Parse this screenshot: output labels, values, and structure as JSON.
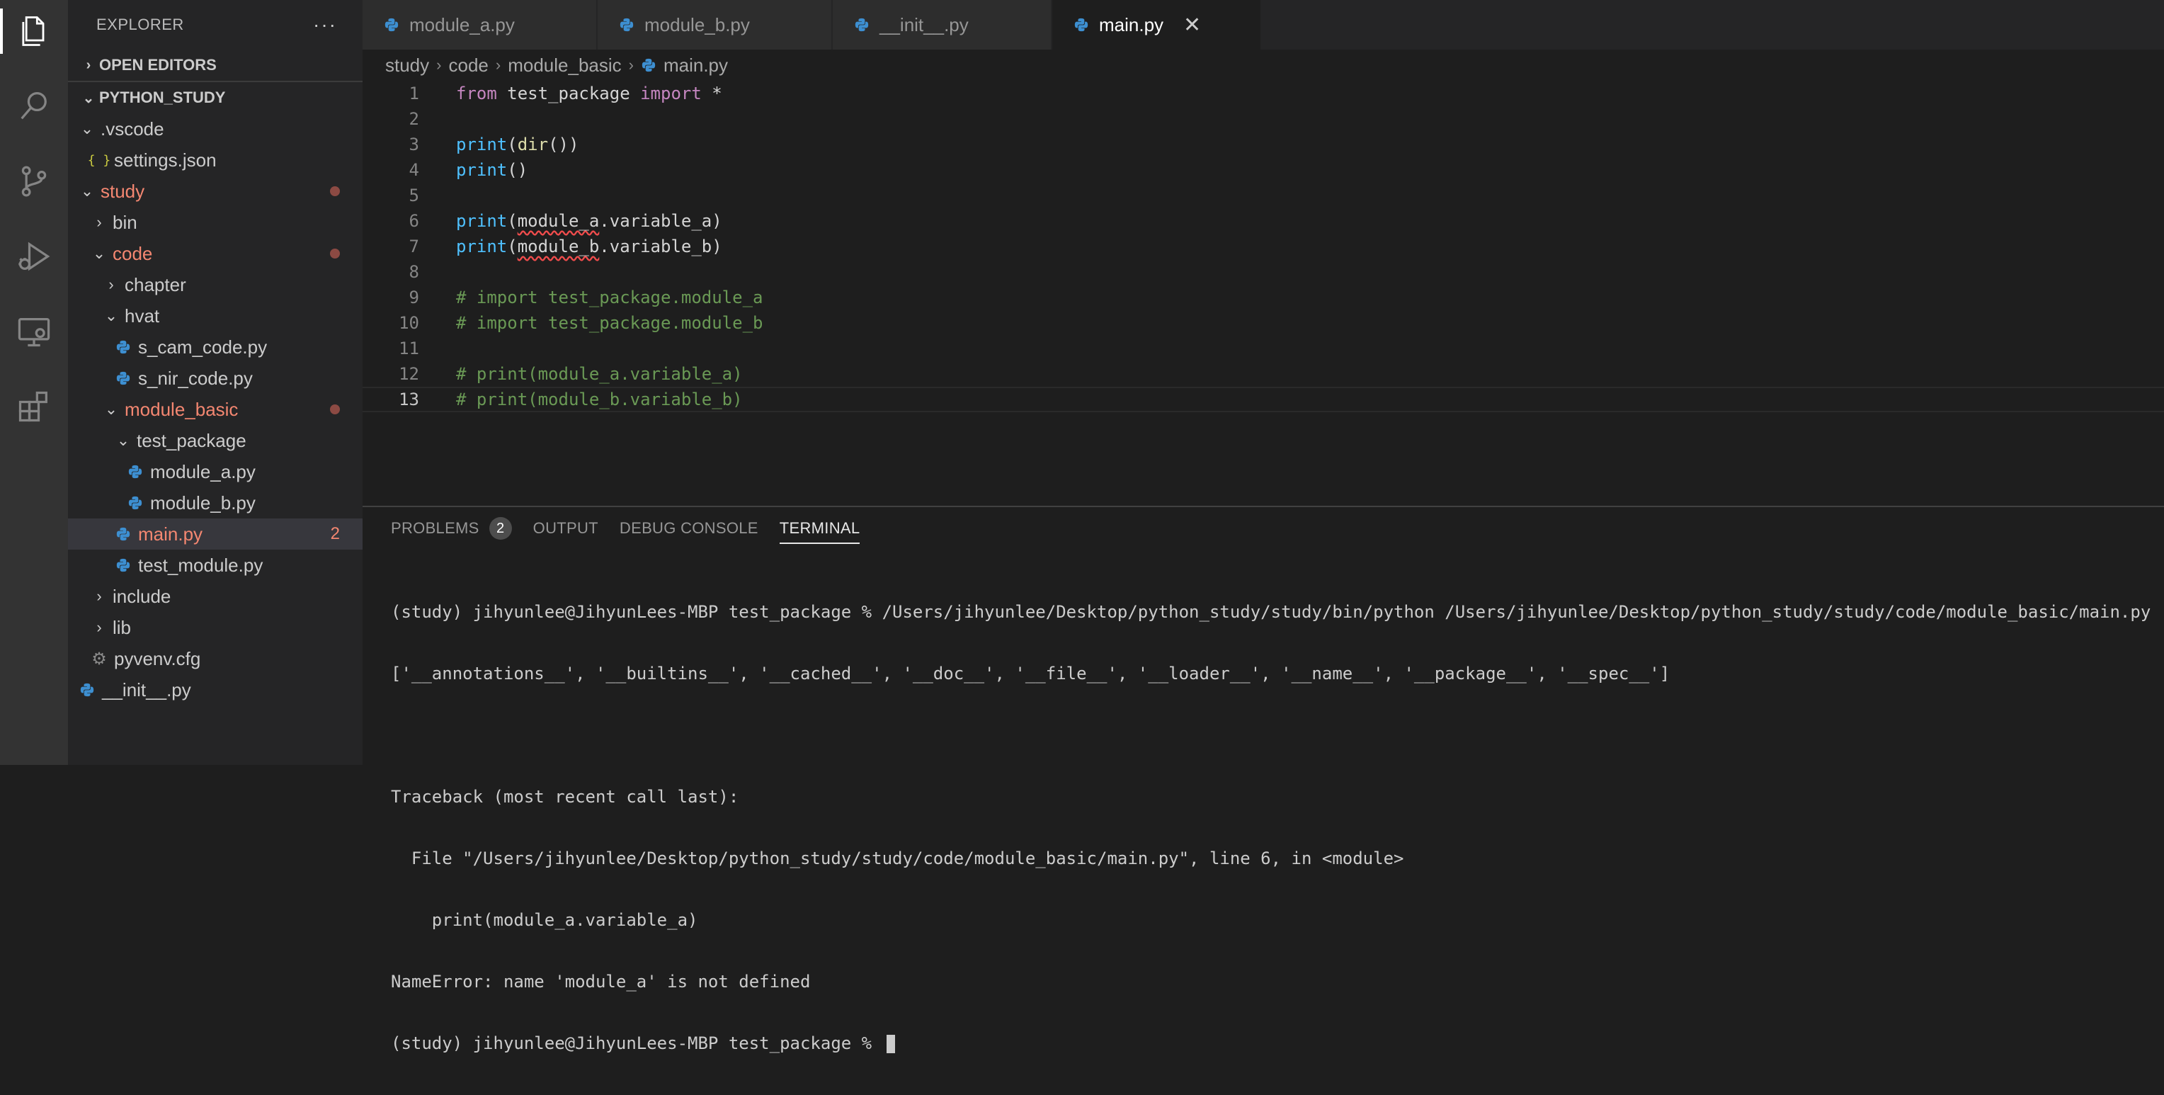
{
  "activity_bar": {
    "icons": [
      "explorer-icon",
      "search-icon",
      "source-control-icon",
      "run-debug-icon",
      "remote-explorer-icon",
      "extensions-icon"
    ]
  },
  "sidebar": {
    "title": "EXPLORER",
    "more": "···",
    "open_editors": "OPEN EDITORS",
    "project": "PYTHON_STUDY",
    "tree": [
      {
        "label": ".vscode",
        "type": "folder",
        "open": true
      },
      {
        "label": "settings.json",
        "type": "json"
      },
      {
        "label": "study",
        "type": "folder",
        "open": true,
        "modified": true
      },
      {
        "label": "bin",
        "type": "folder",
        "open": false
      },
      {
        "label": "code",
        "type": "folder",
        "open": true,
        "modified": true
      },
      {
        "label": "chapter",
        "type": "folder",
        "open": false
      },
      {
        "label": "hvat",
        "type": "folder",
        "open": true
      },
      {
        "label": "s_cam_code.py",
        "type": "python"
      },
      {
        "label": "s_nir_code.py",
        "type": "python"
      },
      {
        "label": "module_basic",
        "type": "folder",
        "open": true,
        "modified": true
      },
      {
        "label": "test_package",
        "type": "folder",
        "open": true
      },
      {
        "label": "module_a.py",
        "type": "python"
      },
      {
        "label": "module_b.py",
        "type": "python"
      },
      {
        "label": "main.py",
        "type": "python",
        "modified": true,
        "count": "2"
      },
      {
        "label": "test_module.py",
        "type": "python"
      },
      {
        "label": "include",
        "type": "folder",
        "open": false
      },
      {
        "label": "lib",
        "type": "folder",
        "open": false
      },
      {
        "label": "pyvenv.cfg",
        "type": "config"
      },
      {
        "label": "__init__.py",
        "type": "python"
      }
    ]
  },
  "tabs": [
    {
      "label": "module_a.py"
    },
    {
      "label": "module_b.py"
    },
    {
      "label": "__init__.py"
    },
    {
      "label": "main.py",
      "close": "✕"
    }
  ],
  "breadcrumb": [
    "study",
    "code",
    "module_basic",
    "main.py"
  ],
  "editor": {
    "line_numbers": [
      "1",
      "2",
      "3",
      "4",
      "5",
      "6",
      "7",
      "8",
      "9",
      "10",
      "11",
      "12",
      "13"
    ],
    "lines": [
      {
        "t1": "from",
        "t2": " test_package ",
        "t3": "import",
        "t4": " *"
      },
      {},
      {
        "fn": "print",
        "p1": "(",
        "fn2": "dir",
        "p2": "())"
      },
      {
        "fn": "print",
        "p1": "()"
      },
      {},
      {
        "fn": "print",
        "p1": "(",
        "sq": "module_a",
        "rest": ".variable_a)"
      },
      {
        "fn": "print",
        "p1": "(",
        "sq": "module_b",
        "rest": ".variable_b)"
      },
      {},
      {
        "cm": "# import test_package.module_a"
      },
      {
        "cm": "# import test_package.module_b"
      },
      {},
      {
        "cm": "# print(module_a.variable_a)"
      },
      {
        "cm": "# print(module_b.variable_b)"
      }
    ]
  },
  "panel": {
    "tabs": [
      "PROBLEMS",
      "OUTPUT",
      "DEBUG CONSOLE",
      "TERMINAL"
    ],
    "problems_count": "2",
    "terminal_lines": [
      "(study) jihyunlee@JihyunLees-MBP test_package % /Users/jihyunlee/Desktop/python_study/study/bin/python /Users/jihyunlee/Desktop/python_study/study/code/module_basic/main.py",
      "['__annotations__', '__builtins__', '__cached__', '__doc__', '__file__', '__loader__', '__name__', '__package__', '__spec__']",
      "",
      "Traceback (most recent call last):",
      "  File \"/Users/jihyunlee/Desktop/python_study/study/code/module_basic/main.py\", line 6, in <module>",
      "    print(module_a.variable_a)",
      "NameError: name 'module_a' is not defined",
      "(study) jihyunlee@JihyunLees-MBP test_package % "
    ]
  },
  "colors": {
    "modified": "#f48771",
    "python_blue": "#3d8fd1",
    "python_yellow": "#f5d04b",
    "comment": "#6a9955"
  }
}
